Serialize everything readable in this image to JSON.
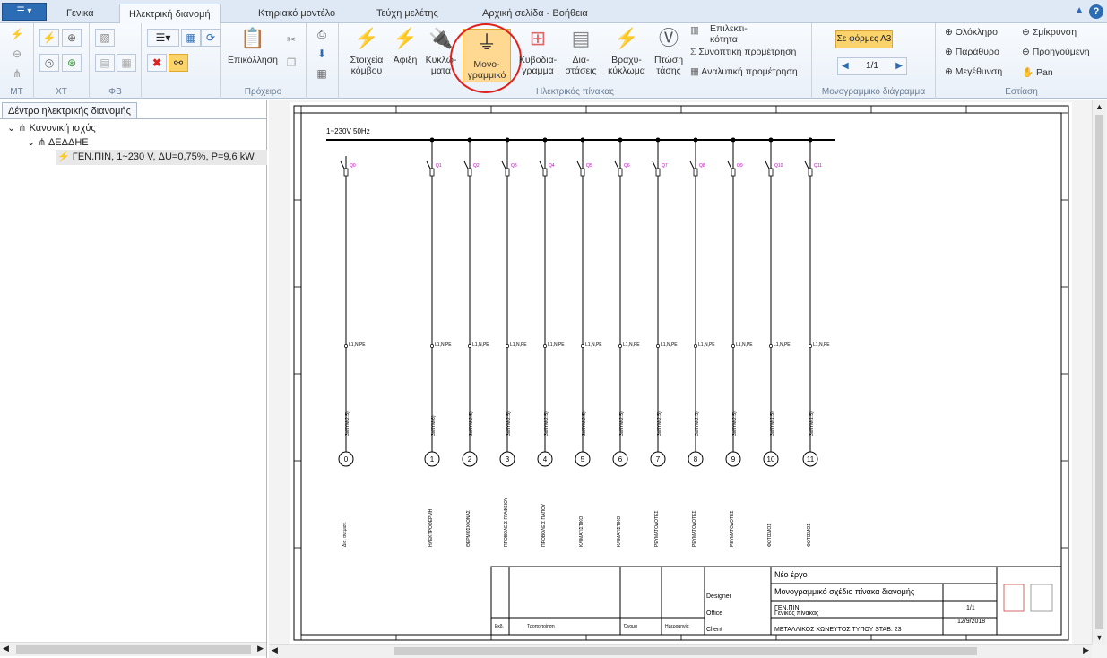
{
  "ribbon_tabs": [
    "Γενικά",
    "Ηλεκτρική διανομή",
    "Κτηριακό μοντέλο",
    "Τεύχη μελέτης",
    "Αρχική σελίδα - Βοήθεια"
  ],
  "small_groups": {
    "mt": "ΜΤ",
    "xt": "ΧΤ",
    "fb": "ΦΒ"
  },
  "clipboard": {
    "paste": "Επικόλληση",
    "label": "Πρόχειρο"
  },
  "elec_panel": {
    "label": "Ηλεκτρικός πίνακας",
    "node_elements": "Στοιχεία κόμβου",
    "arrival": "Άφιξη",
    "circuits": "Κυκλώ-ματα",
    "single_line": "Μονο-γραμμικό",
    "cable_trays": "Κυβοδια-γραμμα",
    "dimensions": "Δια-στάσεις",
    "short_circuit": "Βραχυ-κύκλωμα",
    "voltage_drop": "Πτώση τάσης",
    "selectivity": "Επιλεκτι-κότητα",
    "summary_measure": "Συνοπτική προμέτρηση",
    "analytic_measure": "Αναλυτική προμέτρηση"
  },
  "diagram_group": {
    "label": "Μονογραμμικό διάγραμμα",
    "format_button": "Σε φόρμες Α3",
    "page": "1/1"
  },
  "focus": {
    "label": "Εστίαση",
    "whole": "Ολόκληρο",
    "window": "Παράθυρο",
    "zoom_in": "Μεγέθυνση",
    "zoom_out": "Σμίκρυνση",
    "previous": "Προηγούμενη",
    "pan": "Pan"
  },
  "tree": {
    "title": "Δέντρο ηλεκτρικής διανομής",
    "root": "Κανονική ισχύς",
    "child": "ΔΕΔΔΗΕ",
    "panel": "ΓΕΝ.ΠΙΝ, 1~230 V, ΔU=0,75%, P=9,6 kW,"
  },
  "drawing": {
    "supply": "1~230V 50Hz",
    "bus_label": "L1,N,PE",
    "feeders": [
      "0",
      "1",
      "2",
      "3",
      "4",
      "5",
      "6",
      "7",
      "8",
      "9",
      "10",
      "11"
    ],
    "loads": [
      "Δια. ανεμιστ.",
      "ΗΛΕΚΤΡΟΘΕΡΜΗ",
      "ΘΕΡΜΟΣΙΦΩΝΑΣ",
      "ΠΡΟΒΟΛΕΙΣ ΓΡΑΦΕΙΟΥ",
      "ΠΡΟΒΟΛΕΙΣ ΠΑΠΟΥ",
      "ΚΛΙΜΑΤΙΣΤΙΚΟ",
      "ΚΛΙΜΑΤΙΣΤΙΚΟ",
      "ΡΕΥΜΑΤΟΔΟΤΕΣ",
      "ΡΕΥΜΑΤΟΔΟΤΕΣ",
      "ΡΕΥΜΑΤΟΔΟΤΕΣ",
      "ΦΩΤΙΣΜΟΣ",
      "ΦΩΤΙΣΜΟΣ"
    ],
    "cables": [
      "3xNYM(2.5)",
      "3xNYM(6)",
      "3xNYM(2.5)",
      "3xNYM(2.5)",
      "3xNYM(2.5)",
      "3xNYM(2.5)",
      "3xNYM(2.5)",
      "3xNYM(2.5)",
      "3xNYM(2.5)",
      "3xNYM(2.5)",
      "3xNYM(1.5)",
      "3xNYM(1.5)"
    ],
    "title_block": {
      "project": "Νέο έργο",
      "drawing_title": "Μονογραμμικό σχέδιο πίνακα διανομής",
      "designer": "Designer",
      "panel": "ΓΕΝ.ΠΙΝ",
      "office": "Office",
      "location": "Γενικός πίνακας",
      "client": "Client",
      "address": "ΜΕΤΑΛΛΙΚΟΣ ΧΩΝΕΥΤΟΣ ΤΥΠΟΥ STAB. 23",
      "sheet_no": "1/1",
      "date": "12/9/2018",
      "rev_cols": [
        "Εκδ.",
        "Τροποποίηση",
        "Όνομα",
        "Ημερομηνία"
      ]
    }
  }
}
